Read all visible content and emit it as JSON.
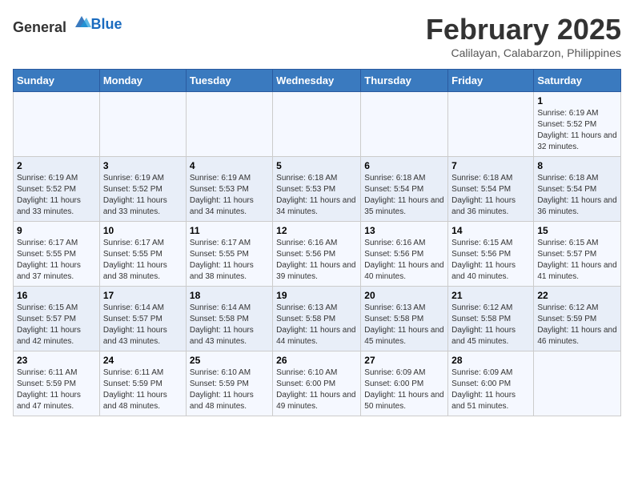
{
  "header": {
    "logo_general": "General",
    "logo_blue": "Blue",
    "title": "February 2025",
    "subtitle": "Calilayan, Calabarzon, Philippines"
  },
  "weekdays": [
    "Sunday",
    "Monday",
    "Tuesday",
    "Wednesday",
    "Thursday",
    "Friday",
    "Saturday"
  ],
  "weeks": [
    [
      {
        "day": "",
        "detail": ""
      },
      {
        "day": "",
        "detail": ""
      },
      {
        "day": "",
        "detail": ""
      },
      {
        "day": "",
        "detail": ""
      },
      {
        "day": "",
        "detail": ""
      },
      {
        "day": "",
        "detail": ""
      },
      {
        "day": "1",
        "detail": "Sunrise: 6:19 AM\nSunset: 5:52 PM\nDaylight: 11 hours and 32 minutes."
      }
    ],
    [
      {
        "day": "2",
        "detail": "Sunrise: 6:19 AM\nSunset: 5:52 PM\nDaylight: 11 hours and 33 minutes."
      },
      {
        "day": "3",
        "detail": "Sunrise: 6:19 AM\nSunset: 5:52 PM\nDaylight: 11 hours and 33 minutes."
      },
      {
        "day": "4",
        "detail": "Sunrise: 6:19 AM\nSunset: 5:53 PM\nDaylight: 11 hours and 34 minutes."
      },
      {
        "day": "5",
        "detail": "Sunrise: 6:18 AM\nSunset: 5:53 PM\nDaylight: 11 hours and 34 minutes."
      },
      {
        "day": "6",
        "detail": "Sunrise: 6:18 AM\nSunset: 5:54 PM\nDaylight: 11 hours and 35 minutes."
      },
      {
        "day": "7",
        "detail": "Sunrise: 6:18 AM\nSunset: 5:54 PM\nDaylight: 11 hours and 36 minutes."
      },
      {
        "day": "8",
        "detail": "Sunrise: 6:18 AM\nSunset: 5:54 PM\nDaylight: 11 hours and 36 minutes."
      }
    ],
    [
      {
        "day": "9",
        "detail": "Sunrise: 6:17 AM\nSunset: 5:55 PM\nDaylight: 11 hours and 37 minutes."
      },
      {
        "day": "10",
        "detail": "Sunrise: 6:17 AM\nSunset: 5:55 PM\nDaylight: 11 hours and 38 minutes."
      },
      {
        "day": "11",
        "detail": "Sunrise: 6:17 AM\nSunset: 5:55 PM\nDaylight: 11 hours and 38 minutes."
      },
      {
        "day": "12",
        "detail": "Sunrise: 6:16 AM\nSunset: 5:56 PM\nDaylight: 11 hours and 39 minutes."
      },
      {
        "day": "13",
        "detail": "Sunrise: 6:16 AM\nSunset: 5:56 PM\nDaylight: 11 hours and 40 minutes."
      },
      {
        "day": "14",
        "detail": "Sunrise: 6:15 AM\nSunset: 5:56 PM\nDaylight: 11 hours and 40 minutes."
      },
      {
        "day": "15",
        "detail": "Sunrise: 6:15 AM\nSunset: 5:57 PM\nDaylight: 11 hours and 41 minutes."
      }
    ],
    [
      {
        "day": "16",
        "detail": "Sunrise: 6:15 AM\nSunset: 5:57 PM\nDaylight: 11 hours and 42 minutes."
      },
      {
        "day": "17",
        "detail": "Sunrise: 6:14 AM\nSunset: 5:57 PM\nDaylight: 11 hours and 43 minutes."
      },
      {
        "day": "18",
        "detail": "Sunrise: 6:14 AM\nSunset: 5:58 PM\nDaylight: 11 hours and 43 minutes."
      },
      {
        "day": "19",
        "detail": "Sunrise: 6:13 AM\nSunset: 5:58 PM\nDaylight: 11 hours and 44 minutes."
      },
      {
        "day": "20",
        "detail": "Sunrise: 6:13 AM\nSunset: 5:58 PM\nDaylight: 11 hours and 45 minutes."
      },
      {
        "day": "21",
        "detail": "Sunrise: 6:12 AM\nSunset: 5:58 PM\nDaylight: 11 hours and 45 minutes."
      },
      {
        "day": "22",
        "detail": "Sunrise: 6:12 AM\nSunset: 5:59 PM\nDaylight: 11 hours and 46 minutes."
      }
    ],
    [
      {
        "day": "23",
        "detail": "Sunrise: 6:11 AM\nSunset: 5:59 PM\nDaylight: 11 hours and 47 minutes."
      },
      {
        "day": "24",
        "detail": "Sunrise: 6:11 AM\nSunset: 5:59 PM\nDaylight: 11 hours and 48 minutes."
      },
      {
        "day": "25",
        "detail": "Sunrise: 6:10 AM\nSunset: 5:59 PM\nDaylight: 11 hours and 48 minutes."
      },
      {
        "day": "26",
        "detail": "Sunrise: 6:10 AM\nSunset: 6:00 PM\nDaylight: 11 hours and 49 minutes."
      },
      {
        "day": "27",
        "detail": "Sunrise: 6:09 AM\nSunset: 6:00 PM\nDaylight: 11 hours and 50 minutes."
      },
      {
        "day": "28",
        "detail": "Sunrise: 6:09 AM\nSunset: 6:00 PM\nDaylight: 11 hours and 51 minutes."
      },
      {
        "day": "",
        "detail": ""
      }
    ]
  ]
}
